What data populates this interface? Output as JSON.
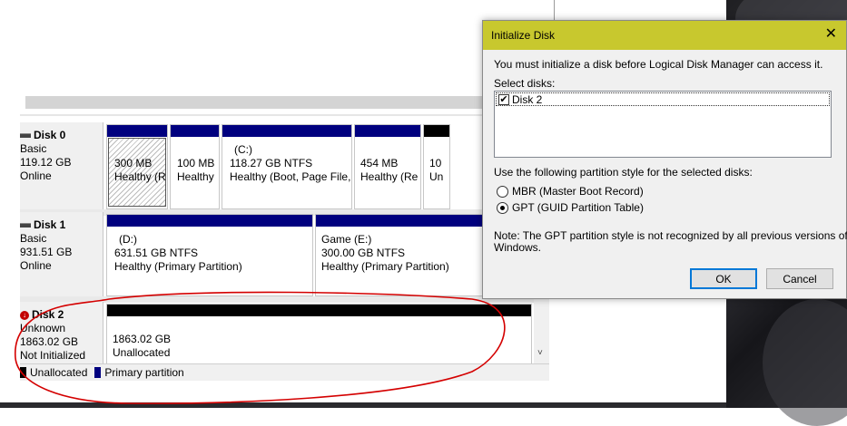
{
  "disks": [
    {
      "name": "Disk 0",
      "kind": "Basic",
      "size": "119.12 GB",
      "status": "Online",
      "partitions": [
        {
          "name": "",
          "size": "300 MB",
          "health": "Healthy (R"
        },
        {
          "name": "",
          "size": "100 MB",
          "health": "Healthy"
        },
        {
          "name": "(C:)",
          "size": "118.27 GB NTFS",
          "health": "Healthy (Boot, Page File,"
        },
        {
          "name": "",
          "size": "454 MB",
          "health": "Healthy (Re"
        },
        {
          "name": "",
          "size": "10",
          "health": "Un"
        }
      ]
    },
    {
      "name": "Disk 1",
      "kind": "Basic",
      "size": "931.51 GB",
      "status": "Online",
      "partitions": [
        {
          "name": "(D:)",
          "size": "631.51 GB NTFS",
          "health": "Healthy (Primary Partition)"
        },
        {
          "name": "Game  (E:)",
          "size": "300.00 GB NTFS",
          "health": "Healthy (Primary Partition)"
        }
      ]
    },
    {
      "name": "Disk 2",
      "kind": "Unknown",
      "size": "1863.02 GB",
      "status": "Not Initialized",
      "partitions": [
        {
          "name": "",
          "size": "1863.02 GB",
          "health": "Unallocated"
        }
      ]
    }
  ],
  "legend": {
    "unallocated": "Unallocated",
    "primary": "Primary partition"
  },
  "colors": {
    "primary": "#00007f",
    "unallocated": "#000000",
    "dialog_title": "#c8c82e",
    "annotation": "#d40000"
  },
  "scroll_down_glyph": "˅",
  "dialog": {
    "title": "Initialize Disk",
    "close_glyph": "✕",
    "message": "You must initialize a disk before Logical Disk Manager can access it.",
    "select_label": "Select disks:",
    "disk_item": "Disk 2",
    "disk_checked": true,
    "style_label": "Use the following partition style for the selected disks:",
    "options": [
      {
        "label": "MBR (Master Boot Record)",
        "selected": false
      },
      {
        "label": "GPT (GUID Partition Table)",
        "selected": true
      }
    ],
    "note_line1": "Note: The GPT partition style is not recognized by all previous versions of",
    "note_line2": "Windows.",
    "ok_label": "OK",
    "cancel_label": "Cancel"
  }
}
